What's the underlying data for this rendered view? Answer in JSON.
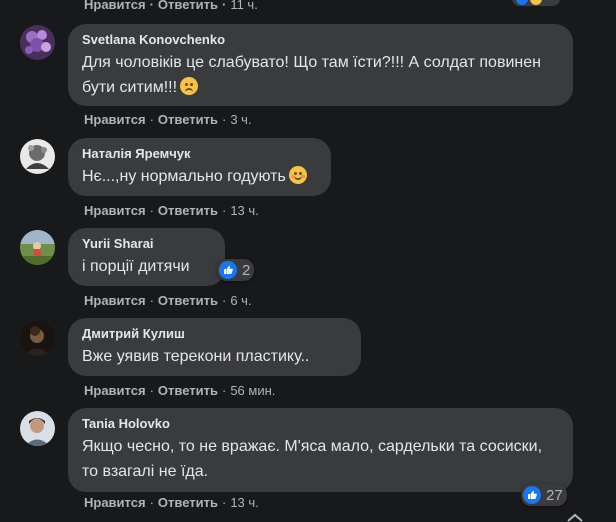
{
  "labels": {
    "like": "Нравится",
    "reply": "Ответить",
    "separator": "·"
  },
  "top_partial": {
    "time": "11 ч."
  },
  "comments": [
    {
      "author": "Svetlana Konovchenko",
      "text": "Для чоловіків це слабувато! Що там їсти?!!! А солдат повинен бути ситим!!!",
      "emoji": "worried-face-emoji",
      "time": "3 ч."
    },
    {
      "author": "Наталія Яремчук",
      "text": "Нє...,ну нормально годують",
      "emoji": "smiling-face-emoji",
      "time": "13 ч."
    },
    {
      "author": "Yurii Sharai",
      "text": "і порції дитячи",
      "reaction_count": "2",
      "time": "6 ч."
    },
    {
      "author": "Дмитрий Кулиш",
      "text": "Вже уявив терекони пластику..",
      "time": "56 мин."
    },
    {
      "author": "Tania Holovko",
      "text": "Якщо чесно, то не вражає. М'яса мало, сардельки та сосиски, то взагалі не їда.",
      "reaction_count": "27",
      "time": "13 ч."
    }
  ],
  "colors": {
    "background": "#18191a",
    "bubble": "#3a3b3c",
    "text_primary": "#e4e6eb",
    "text_secondary": "#b0b3b8",
    "like_blue": "#1877f2"
  }
}
